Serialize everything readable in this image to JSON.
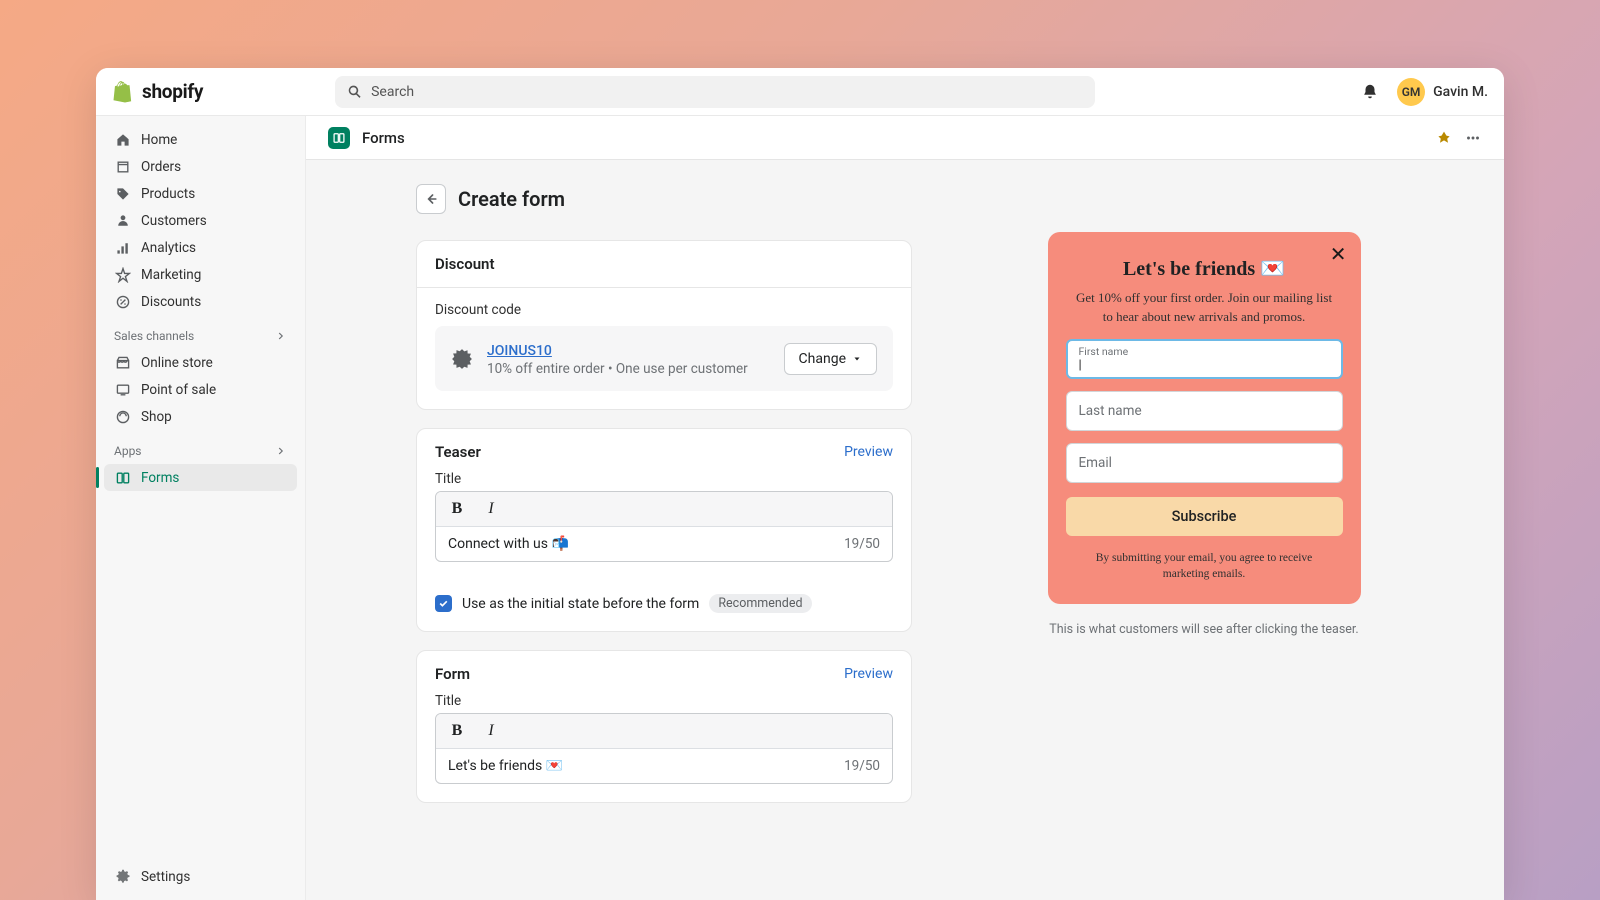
{
  "brand": "shopify",
  "search_placeholder": "Search",
  "user": {
    "initials": "GM",
    "name": "Gavin M."
  },
  "sidebar": {
    "main": [
      {
        "label": "Home",
        "icon": "home"
      },
      {
        "label": "Orders",
        "icon": "orders"
      },
      {
        "label": "Products",
        "icon": "products"
      },
      {
        "label": "Customers",
        "icon": "customers"
      },
      {
        "label": "Analytics",
        "icon": "analytics"
      },
      {
        "label": "Marketing",
        "icon": "marketing"
      },
      {
        "label": "Discounts",
        "icon": "discounts"
      }
    ],
    "channels_header": "Sales channels",
    "channels": [
      {
        "label": "Online store",
        "icon": "store"
      },
      {
        "label": "Point of sale",
        "icon": "pos"
      },
      {
        "label": "Shop",
        "icon": "shop"
      }
    ],
    "apps_header": "Apps",
    "apps": [
      {
        "label": "Forms",
        "icon": "forms",
        "active": true
      }
    ],
    "settings_label": "Settings"
  },
  "subheader": {
    "title": "Forms"
  },
  "page": {
    "title": "Create form",
    "discount": {
      "card_title": "Discount",
      "field_label": "Discount code",
      "code": "JOINUS10",
      "description": "10% off entire order • One use per customer",
      "change_label": "Change"
    },
    "teaser": {
      "card_title": "Teaser",
      "preview_label": "Preview",
      "title_label": "Title",
      "value": "Connect with us 📬",
      "charcount": "19/50",
      "checkbox_label": "Use as the initial state before the form",
      "badge": "Recommended"
    },
    "form": {
      "card_title": "Form",
      "preview_label": "Preview",
      "title_label": "Title",
      "value": "Let's be friends 💌",
      "charcount": "19/50"
    }
  },
  "preview": {
    "title": "Let's be friends 💌",
    "subtitle": "Get 10% off your first order. Join our mailing list to hear about new arrivals and promos.",
    "first_name_label": "First name",
    "last_name_placeholder": "Last name",
    "email_placeholder": "Email",
    "submit_label": "Subscribe",
    "disclaimer": "By submitting your email, you agree to receive marketing emails.",
    "caption": "This is what customers will see after clicking the teaser."
  }
}
